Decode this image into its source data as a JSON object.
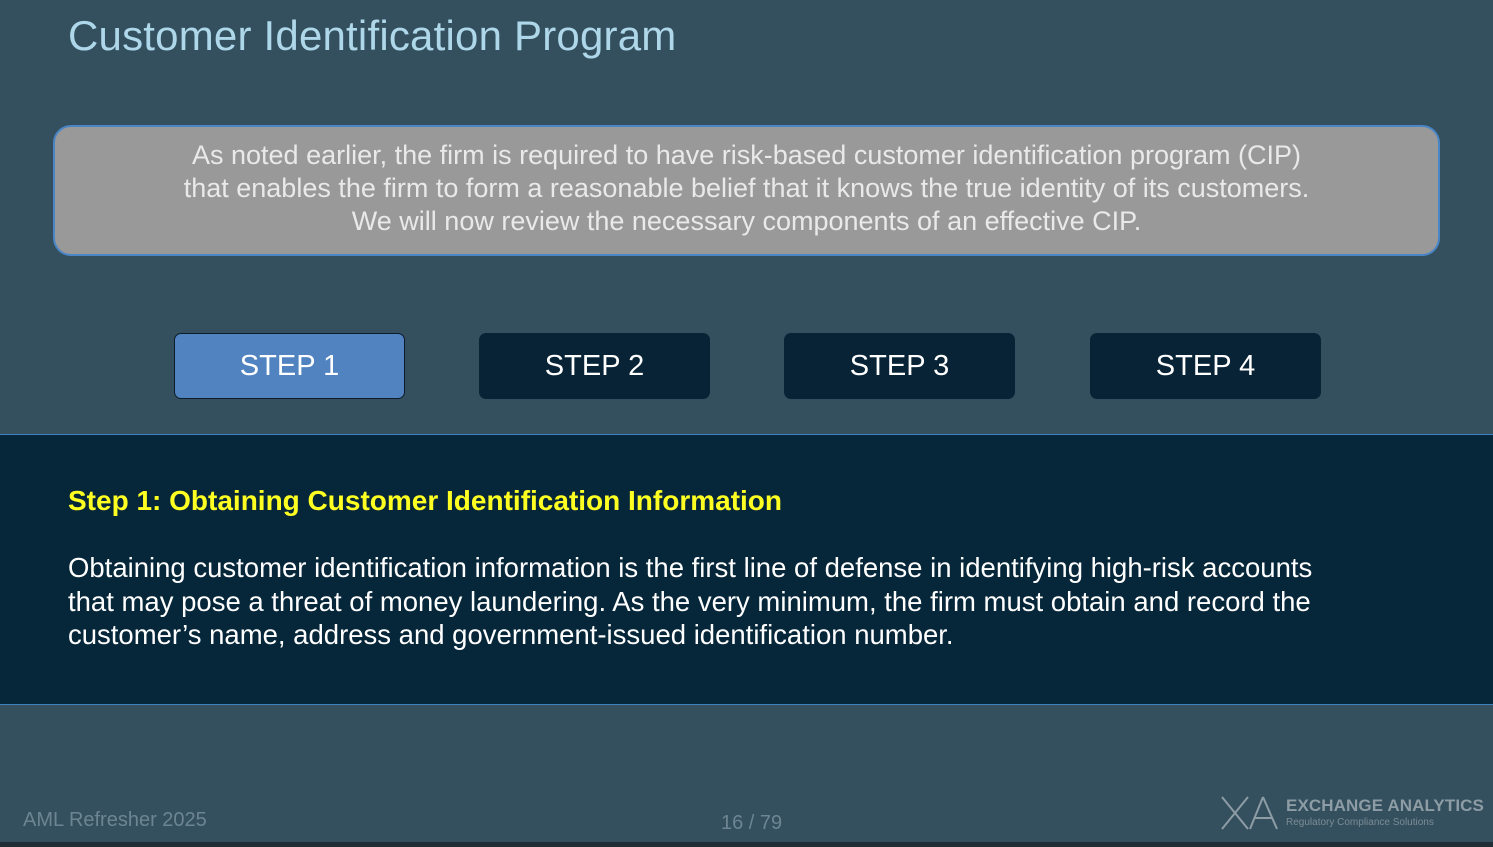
{
  "slide": {
    "title": "Customer Identification Program",
    "intro_lines": [
      "As noted earlier, the firm is required to have risk-based customer identification program (CIP)",
      "that enables the firm to form a reasonable belief that it knows the true identity of its customers.",
      "We will now review the necessary components of an effective CIP."
    ],
    "steps": [
      {
        "label": "STEP 1",
        "active": true
      },
      {
        "label": "STEP 2",
        "active": false
      },
      {
        "label": "STEP 3",
        "active": false
      },
      {
        "label": "STEP 4",
        "active": false
      }
    ],
    "detail": {
      "heading": "Step 1:  Obtaining Customer Identification Information",
      "body_lines": [
        "Obtaining customer identification information is the first line of defense in identifying high-risk accounts",
        "that may pose a threat of money laundering.  As the very minimum, the firm must obtain and record the",
        "customer’s name, address and government-issued identification number."
      ]
    }
  },
  "footer": {
    "course_name": "AML Refresher 2025",
    "page_indicator": "16 / 79",
    "logo_name": "EXCHANGE ANALYTICS",
    "logo_tagline": "Regulatory Compliance Solutions"
  },
  "colors": {
    "background": "#34505e",
    "title": "#aed8ea",
    "intro_box": "#999999",
    "step_active": "#5183c0",
    "step_inactive": "#082336",
    "detail_panel": "#062639",
    "heading_yellow": "#ffff22"
  }
}
